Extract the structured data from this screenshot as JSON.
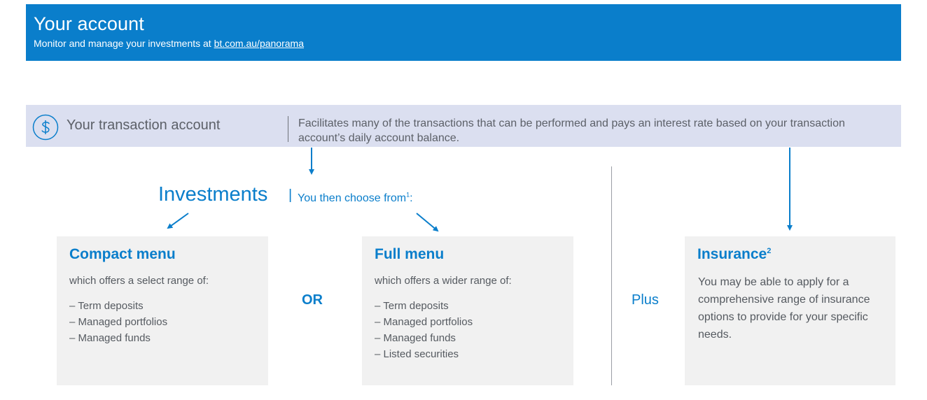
{
  "header": {
    "title": "Your account",
    "subtitle_prefix": "Monitor and manage your investments at ",
    "link_text": "bt.com.au/panorama"
  },
  "transaction_account": {
    "icon": "dollar-icon",
    "label": "Your transaction account",
    "description": "Facilitates many of the transactions that can be performed and pays an interest rate based on your transaction account’s daily account balance."
  },
  "investments": {
    "title": "Investments",
    "separator": "|",
    "subtitle": "You then choose from",
    "footnote": "1",
    "suffix": ":"
  },
  "compact_menu": {
    "title": "Compact menu",
    "lead": "which offers a select range of:",
    "items": [
      "– Term deposits",
      "– Managed portfolios",
      "– Managed funds"
    ]
  },
  "or_label": "OR",
  "full_menu": {
    "title": "Full menu",
    "lead": "which offers a wider range of:",
    "items": [
      "– Term deposits",
      "– Managed portfolios",
      "– Managed funds",
      "– Listed securities"
    ]
  },
  "plus_label": "Plus",
  "insurance": {
    "title": "Insurance",
    "footnote": "2",
    "body": "You may be able to apply for a comprehensive range of insurance options to provide for your specific needs."
  },
  "colors": {
    "brand_blue": "#0a7ecb",
    "band_lavender": "#dbdff0",
    "card_grey": "#f1f1f1",
    "text_grey": "#555a60"
  }
}
